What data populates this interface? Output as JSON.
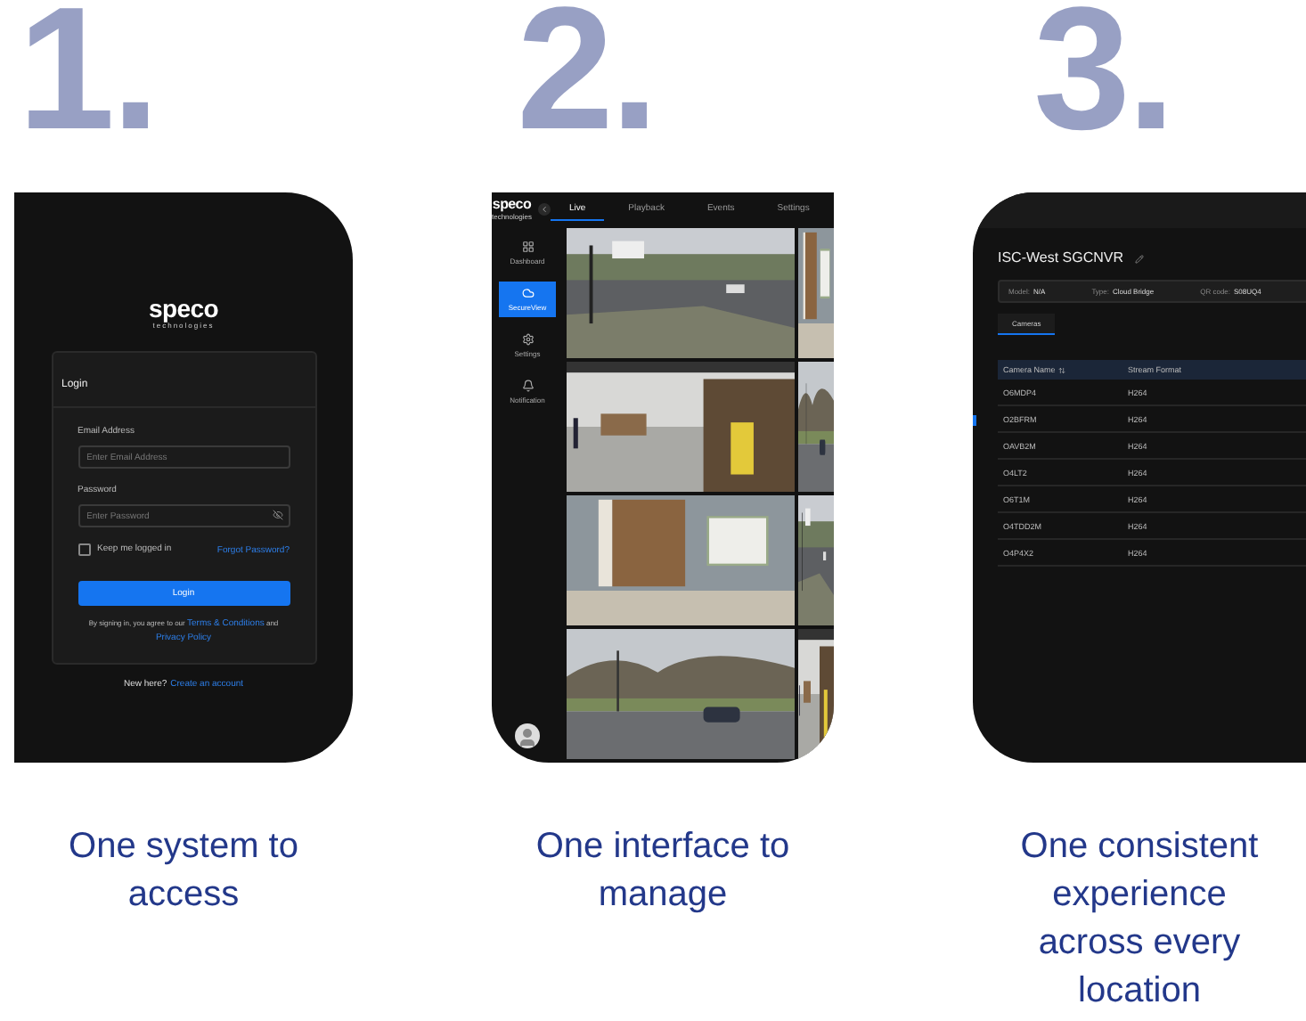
{
  "steps": [
    {
      "number": "1.",
      "kind": "login",
      "caption": "One system to access",
      "screen": {
        "logo": "speco",
        "logo_sub": "technologies",
        "card_title": "Login",
        "email_label": "Email Address",
        "email_placeholder": "Enter Email Address",
        "password_label": "Password",
        "password_placeholder": "Enter Password",
        "remember": {
          "label": "Keep me logged in",
          "checked": false
        },
        "forgot": "Forgot Password?",
        "button": "Login",
        "terms": "By signing in, you agree to our",
        "terms_link": "Terms & Conditions",
        "terms_and": "and",
        "privacy_link": "Privacy Policy",
        "new_here": "New here?",
        "create": "Create an account"
      }
    },
    {
      "number": "2.",
      "kind": "live",
      "caption": "One interface to manage",
      "screen": {
        "logo": "speco",
        "logo_sub": "technologies",
        "tabs": [
          {
            "label": "Live",
            "selected": true
          },
          {
            "label": "Playback",
            "selected": false
          },
          {
            "label": "Events",
            "selected": false
          },
          {
            "label": "Settings",
            "selected": false
          }
        ],
        "nav": [
          {
            "label": "Dashboard",
            "selected": false
          },
          {
            "label": "SecureView",
            "selected": true
          },
          {
            "label": "Settings",
            "selected": false
          },
          {
            "label": "Notification",
            "selected": false
          }
        ]
      }
    },
    {
      "number": "3.",
      "kind": "device",
      "caption": "One consistent experience across every location",
      "screen": {
        "title": "ISC-West SGCNVR",
        "info": [
          {
            "label": "Model:",
            "value": "N/A"
          },
          {
            "label": "Type:",
            "value": "Cloud Bridge"
          },
          {
            "label": "QR code:",
            "value": "S08UQ4"
          }
        ],
        "tabs": [
          {
            "label": "Cameras",
            "selected": true
          }
        ],
        "columns": [
          "Camera Name",
          "Stream Format"
        ],
        "rows": [
          [
            "O6MDP4",
            "H264"
          ],
          [
            "O2BFRM",
            "H264"
          ],
          [
            "OAVB2M",
            "H264"
          ],
          [
            "O4LT2",
            "H264"
          ],
          [
            "O6T1M",
            "H264"
          ],
          [
            "O4TDD2M",
            "H264"
          ],
          [
            "O4P4X2",
            "H264"
          ]
        ]
      }
    }
  ]
}
